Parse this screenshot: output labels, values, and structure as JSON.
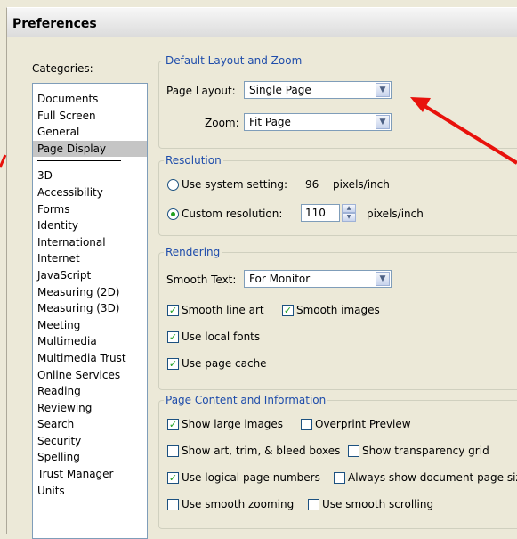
{
  "window": {
    "title": "Preferences"
  },
  "categories": {
    "label": "Categories:",
    "top": [
      "Documents",
      "Full Screen",
      "General",
      "Page Display"
    ],
    "selected": "Page Display",
    "bottom": [
      "3D",
      "Accessibility",
      "Forms",
      "Identity",
      "International",
      "Internet",
      "JavaScript",
      "Measuring (2D)",
      "Measuring (3D)",
      "Meeting",
      "Multimedia",
      "Multimedia Trust",
      "Online Services",
      "Reading",
      "Reviewing",
      "Search",
      "Security",
      "Spelling",
      "Trust Manager",
      "Units"
    ]
  },
  "layout": {
    "legend": "Default Layout and Zoom",
    "page_layout_label": "Page Layout:",
    "page_layout_value": "Single Page",
    "zoom_label": "Zoom:",
    "zoom_value": "Fit Page"
  },
  "resolution": {
    "legend": "Resolution",
    "system_label": "Use system setting:",
    "system_value": "96",
    "system_unit": "pixels/inch",
    "custom_label": "Custom resolution:",
    "custom_value": "110",
    "custom_unit": "pixels/inch",
    "selected": "custom"
  },
  "rendering": {
    "legend": "Rendering",
    "smooth_text_label": "Smooth Text:",
    "smooth_text_value": "For Monitor",
    "smooth_line_art": "Smooth line art",
    "smooth_images": "Smooth images",
    "local_fonts": "Use local fonts",
    "page_cache": "Use page cache"
  },
  "page_content": {
    "legend": "Page Content and Information",
    "show_large_images": "Show large images",
    "overprint_preview": "Overprint Preview",
    "show_art_boxes": "Show art, trim, & bleed boxes",
    "show_transparency_grid": "Show transparency grid",
    "logical_page_numbers": "Use logical page numbers",
    "always_show_doc_size": "Always show document page size",
    "smooth_zooming": "Use smooth zooming",
    "smooth_scrolling": "Use smooth scrolling"
  },
  "colors": {
    "legend": "#1f4dab",
    "annotation_arrow": "#e8120c",
    "check": "#21a121"
  }
}
